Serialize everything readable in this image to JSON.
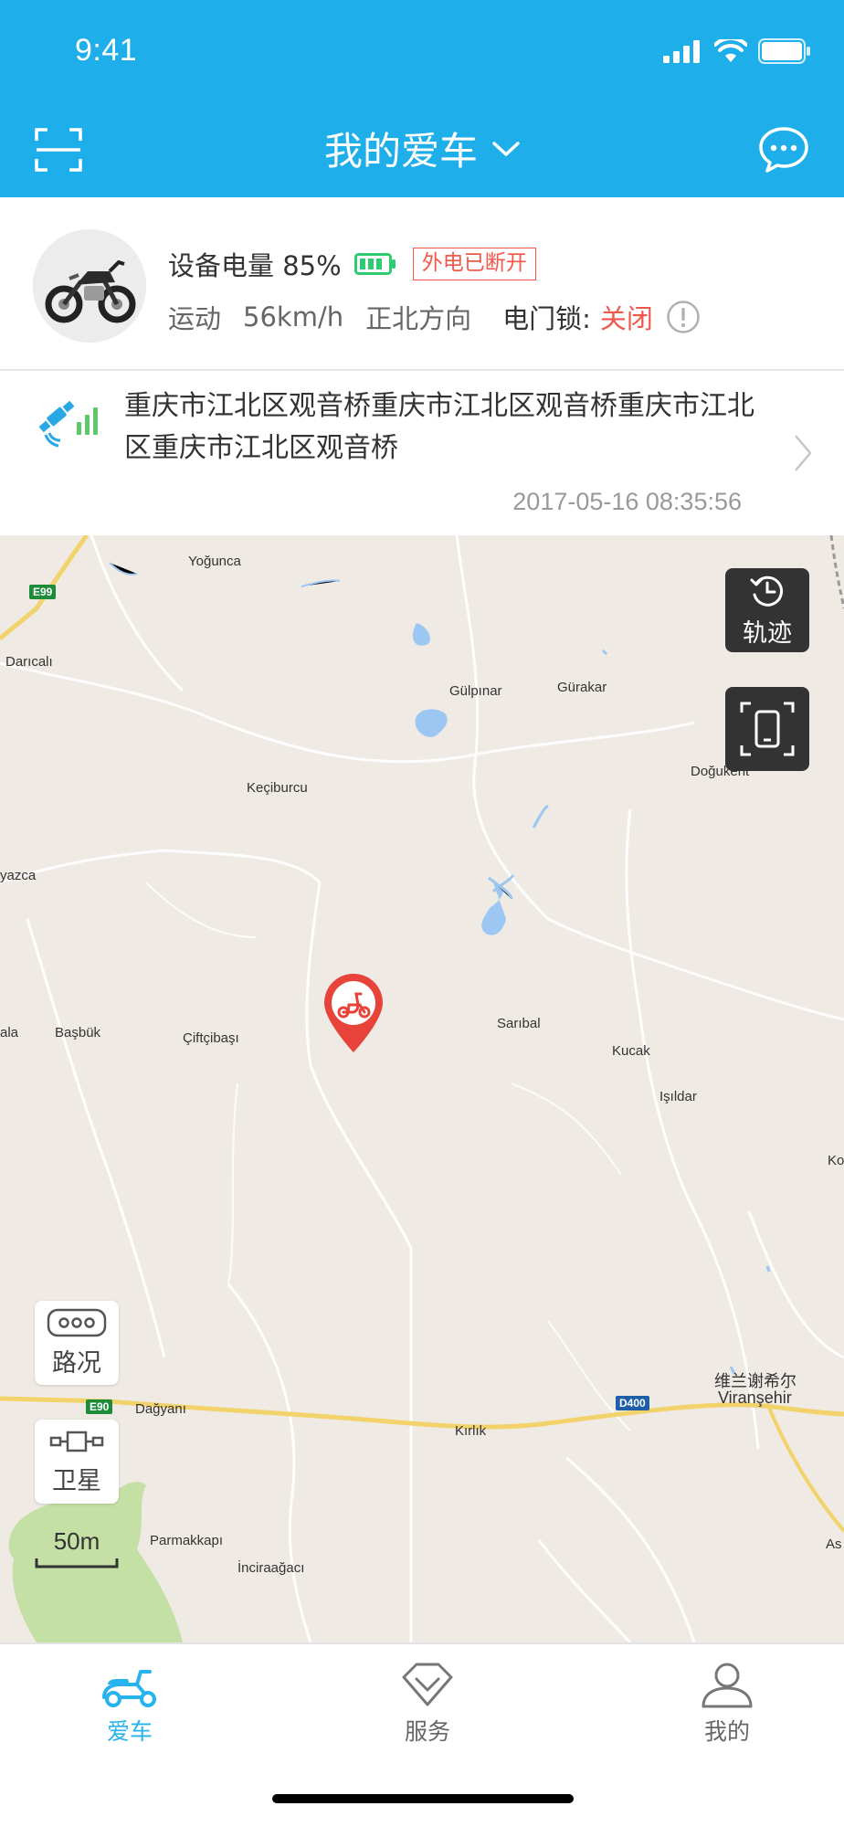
{
  "status": {
    "time": "9:41"
  },
  "nav": {
    "title": "我的爱车"
  },
  "vehicle": {
    "battery_label": "设备电量 85%",
    "battery_level": 0.85,
    "power_badge": "外电已断开",
    "motion": "运动",
    "speed": "56km/h",
    "direction": "正北方向",
    "lock_label": "电门锁:",
    "lock_value": "关闭",
    "colors": {
      "accent": "#1eaee9",
      "alert": "#f1574a",
      "battery": "#2ecc71"
    }
  },
  "location": {
    "address": "重庆市江北区观音桥重庆市江北区观音桥重庆市江北区重庆市江北区观音桥",
    "timestamp": "2017-05-16 08:35:56"
  },
  "map": {
    "places": {
      "yogunca": "Yoğunca",
      "daricali": "Darıcalı",
      "gulpinar": "Gülpınar",
      "gurakar": "Gürakar",
      "dogukent": "Doğukent",
      "keciburcu": "Keçiburcu",
      "yazca": "yazca",
      "sariball": "Sarıbal",
      "kucak": "Kucak",
      "isildar": "Işıldar",
      "ala": "ala",
      "basbuk": "Başbük",
      "ciftcibasi": "Çiftçibaşı",
      "dagyani": "Dağyanı",
      "kirlik": "Kırlık",
      "viransehir_cn": "维兰谢希尔",
      "viransehir": "Viranşehir",
      "parmakkapi": "Parmakkapı",
      "inciragaci": "İnciraağacı",
      "ko": "Ko",
      "as": "As"
    },
    "road_badges": {
      "e99": "E99",
      "e90": "E90",
      "d400": "D400"
    },
    "buttons": {
      "track": "轨迹",
      "traffic": "路况",
      "satellite": "卫星"
    },
    "scale": "50m"
  },
  "tabs": [
    {
      "label": "爱车",
      "icon": "scooter-icon",
      "active": true
    },
    {
      "label": "服务",
      "icon": "diamond-icon",
      "active": false
    },
    {
      "label": "我的",
      "icon": "person-icon",
      "active": false
    }
  ]
}
